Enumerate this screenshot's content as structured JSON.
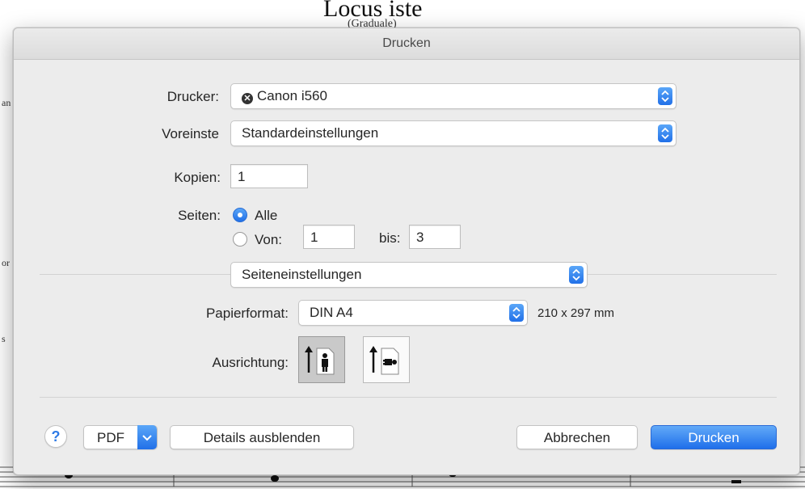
{
  "document": {
    "title": "Locus iste",
    "subtitle": "(Graduale)"
  },
  "dialog": {
    "title": "Drucken",
    "printer": {
      "label": "Drucker:",
      "value": "Canon i560",
      "status_icon": "error-x-icon"
    },
    "presets": {
      "label": "Voreinste",
      "value": "Standardeinstellungen"
    },
    "copies": {
      "label": "Kopien:",
      "value": "1"
    },
    "pages": {
      "label": "Seiten:",
      "all_label": "Alle",
      "from_label": "Von:",
      "from_value": "1",
      "to_label": "bis:",
      "to_value": "3",
      "selected": "all"
    },
    "section": {
      "value": "Seiteneinstellungen"
    },
    "paper": {
      "label": "Papierformat:",
      "value": "DIN A4",
      "dimensions": "210 x 297 mm"
    },
    "orientation": {
      "label": "Ausrichtung:",
      "selected": "portrait"
    },
    "buttons": {
      "help": "?",
      "pdf": "PDF",
      "details": "Details ausblenden",
      "cancel": "Abbrechen",
      "print": "Drucken"
    }
  },
  "colors": {
    "accent": "#2a7ae8",
    "dialog_bg": "#ececec"
  }
}
